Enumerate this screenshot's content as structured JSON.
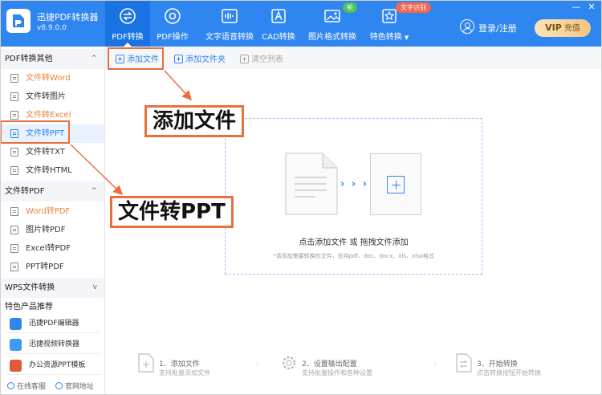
{
  "app": {
    "name": "迅捷PDF转换器",
    "version": "v8.9.0.0"
  },
  "nav": {
    "items": [
      {
        "label": "PDF转换"
      },
      {
        "label": "PDF操作"
      },
      {
        "label": "文字语音转换"
      },
      {
        "label": "CAD转换"
      },
      {
        "label": "图片格式转换"
      },
      {
        "label": "特色转换"
      }
    ],
    "badge_new": "新",
    "badge_ocr": "文字识别",
    "dropdown_arrow": "▼"
  },
  "header_right": {
    "login_label": "登录/注册",
    "vip_label": "VIP",
    "vip_sub": "充值"
  },
  "window_controls": {
    "minimize": "—",
    "close": "✕"
  },
  "sidebar": {
    "group1": {
      "title": "PDF转换其他",
      "chevron": "^"
    },
    "group1_items": [
      {
        "label": "文件转Word"
      },
      {
        "label": "文件转图片"
      },
      {
        "label": "文件转Excel"
      },
      {
        "label": "文件转PPT"
      },
      {
        "label": "文件转TXT"
      },
      {
        "label": "文件转HTML"
      }
    ],
    "group2": {
      "title": "文件转PDF",
      "chevron": "^"
    },
    "group2_items": [
      {
        "label": "Word转PDF"
      },
      {
        "label": "图片转PDF"
      },
      {
        "label": "Excel转PDF"
      },
      {
        "label": "PPT转PDF"
      }
    ],
    "group3": {
      "title": "WPS文件转换",
      "chevron": "v"
    },
    "promo_title": "特色产品推荐",
    "promos": [
      {
        "label": "迅捷PDF编辑器"
      },
      {
        "label": "迅捷视频转换器"
      },
      {
        "label": "办公资源PPT模板"
      }
    ],
    "footer": {
      "service": "在线客服",
      "website": "官网地址"
    }
  },
  "toolbar": {
    "add_file": "添加文件",
    "add_folder": "添加文件夹",
    "clear_list": "清空列表"
  },
  "dropzone": {
    "arrows": "› › ›",
    "main_text": "点击添加文件 或 拖拽文件添加",
    "hint_text": "*请添加需要转换的文件，支持pdf、doc、docx、xls、xlsx格式"
  },
  "steps": [
    {
      "title": "1、添加文件",
      "desc": "支持批量添加文件"
    },
    {
      "title": "2、设置输出配置",
      "desc": "支持批量操作和各种设置"
    },
    {
      "title": "3、开始转换",
      "desc": "点击转换按钮开始转换"
    }
  ],
  "step_separator": "›",
  "annotations": {
    "callout_add": "添加文件",
    "callout_ppt": "文件转PPT"
  },
  "colors": {
    "header_blue": "#2f86f0",
    "accent_orange": "#e8703f",
    "active_blue": "#2f86f0"
  }
}
